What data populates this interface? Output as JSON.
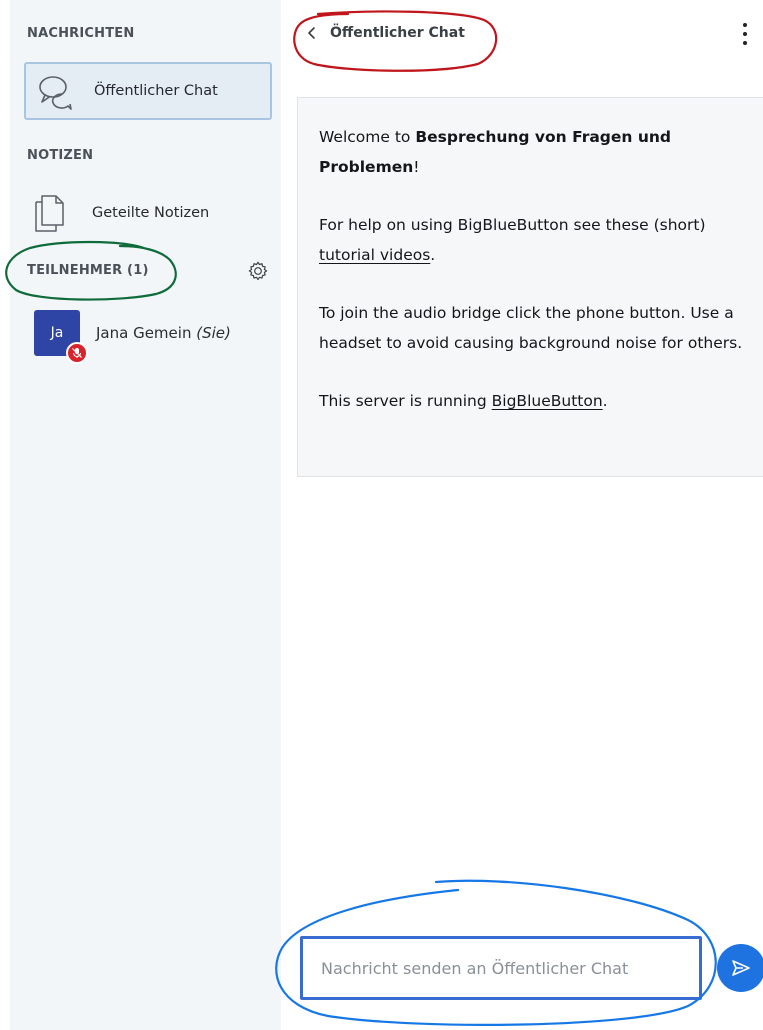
{
  "sidebar": {
    "messages_title": "NACHRICHTEN",
    "public_chat_label": "Öffentlicher Chat",
    "notes_title": "NOTIZEN",
    "shared_notes_label": "Geteilte Notizen",
    "participants_title": "TEILNEHMER (1)",
    "user": {
      "initials": "Ja",
      "name": "Jana Gemein",
      "you_suffix": "(Sie)",
      "status": "muted"
    }
  },
  "chat": {
    "header_title": "Öffentlicher Chat",
    "welcome": {
      "line1_prefix": "Welcome to ",
      "line1_bold": "Besprechung von Fragen und Problemen",
      "line1_suffix": "!",
      "help_prefix": "For help on using BigBlueButton see these (short) ",
      "help_link": "tutorial videos",
      "help_suffix": ".",
      "audio_text": "To join the audio bridge click the phone button. Use a headset to avoid causing background noise for others.",
      "server_prefix": "This server is running ",
      "server_link": "BigBlueButton",
      "server_suffix": "."
    },
    "input_placeholder": "Nachricht senden an Öffentlicher Chat"
  },
  "colors": {
    "accent": "#1e73e0",
    "avatar": "#2f45a5",
    "mute_badge": "#d9232c",
    "annotation_red": "#c0151b",
    "annotation_green": "#0f6b3a",
    "annotation_blue": "#1677e6"
  },
  "icons": {
    "chat": "chat-bubbles-icon",
    "notes": "documents-icon",
    "settings": "gear-icon",
    "back": "chevron-left-icon",
    "more": "kebab-menu-icon",
    "send": "send-icon",
    "muted": "microphone-muted-icon"
  }
}
